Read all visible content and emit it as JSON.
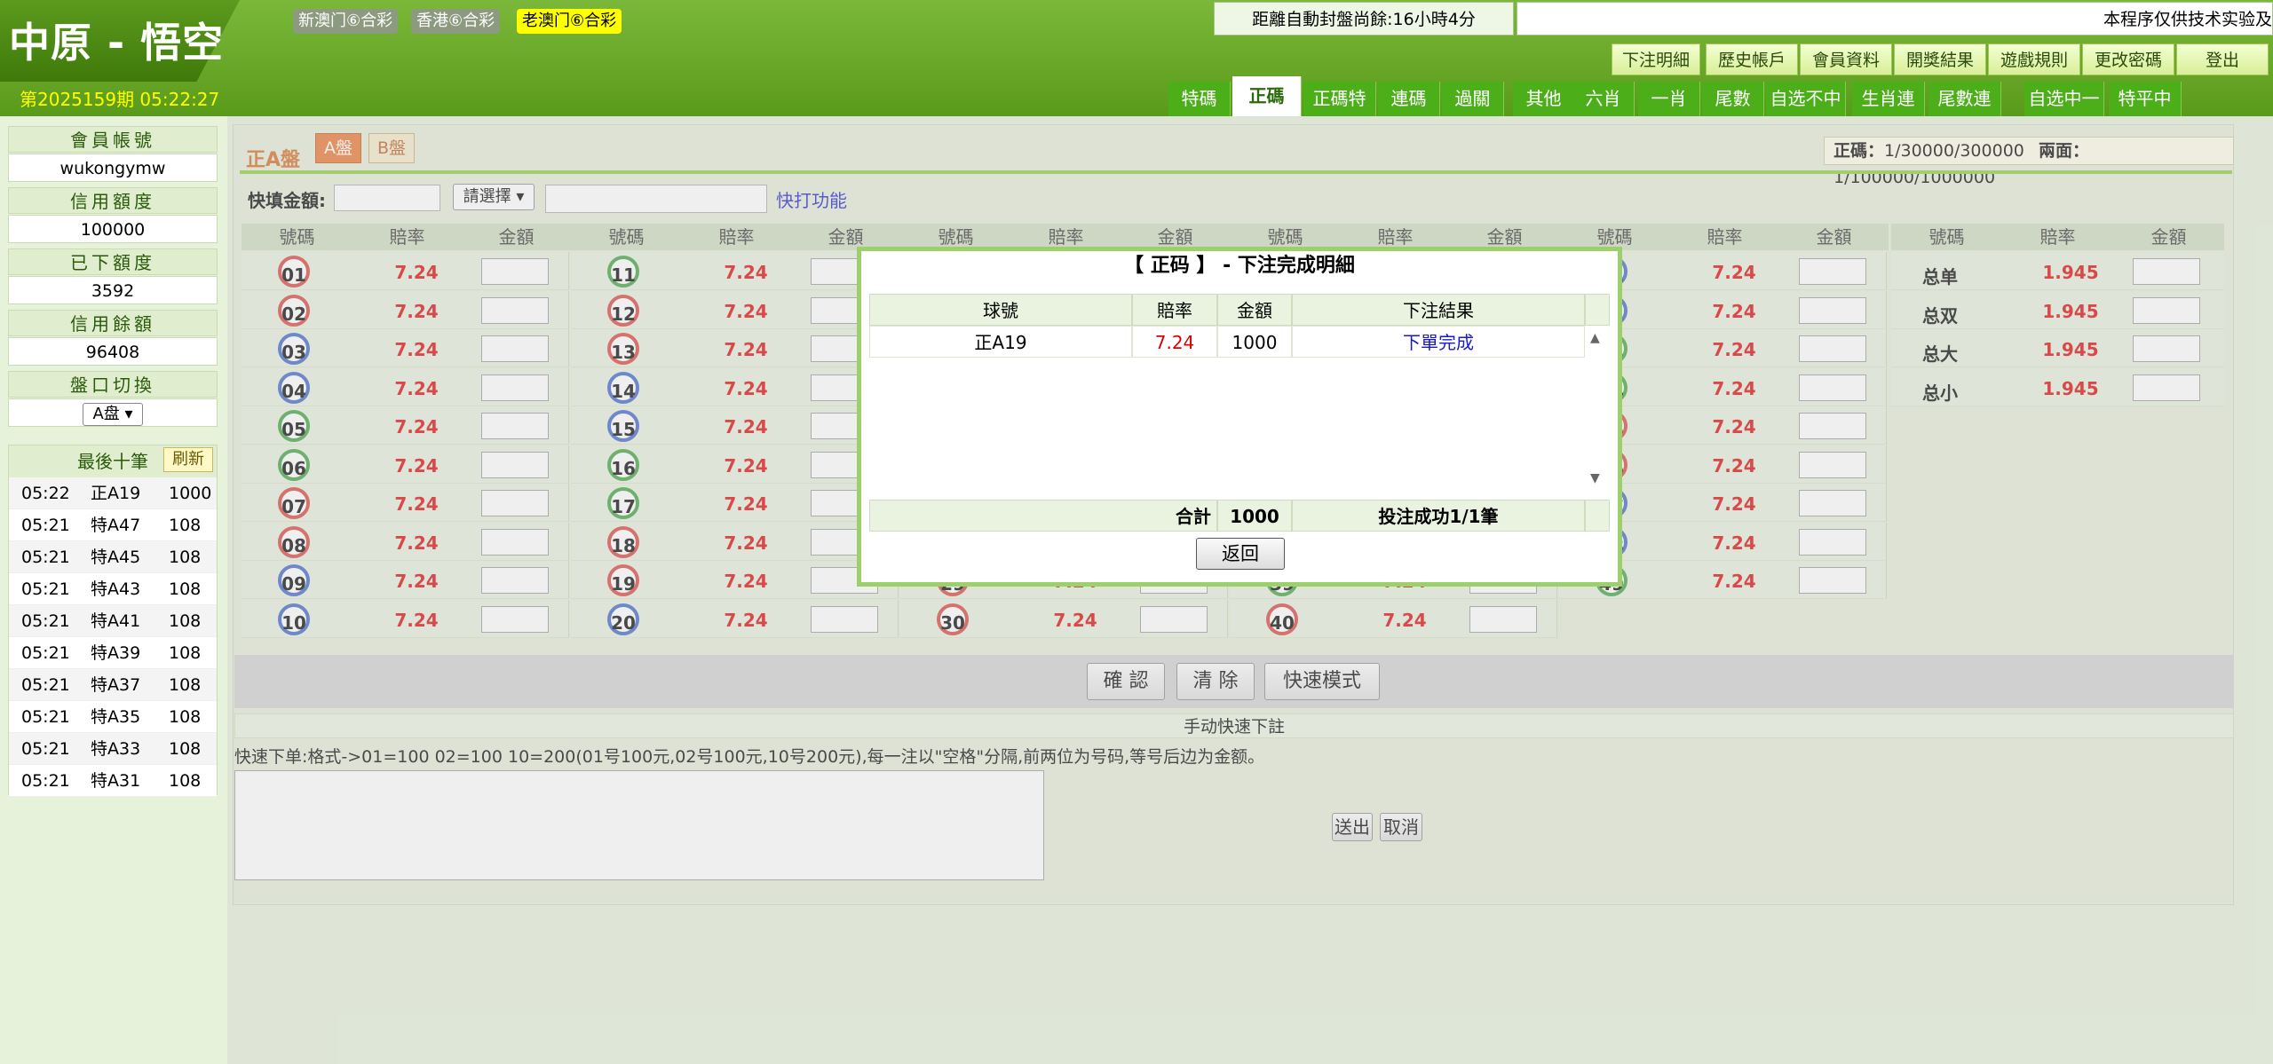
{
  "header": {
    "logo": "中原 - 悟空",
    "period": "第2025159期 05:22:27",
    "lottery_tabs": [
      {
        "label": "新澳门⑥合彩",
        "active": false
      },
      {
        "label": "香港⑥合彩",
        "active": false
      },
      {
        "label": "老澳门⑥合彩",
        "active": true
      }
    ],
    "countdown": "距離自動封盤尚餘:16小時4分",
    "marquee": "本程序仅供技术实验及",
    "top_links": [
      "下注明細",
      "歷史帳戶",
      "會員資料",
      "開獎結果",
      "遊戲規則",
      "更改密碼",
      "登出"
    ],
    "nav_tabs": [
      {
        "label": "特碼",
        "active": false
      },
      {
        "label": "正碼",
        "active": true
      },
      {
        "label": "正碼特",
        "active": false
      },
      {
        "label": "連碼",
        "active": false
      },
      {
        "label": "過關",
        "active": false
      },
      {
        "label": "其他",
        "active": false
      },
      {
        "label": "六肖",
        "active": false
      },
      {
        "label": "一肖",
        "active": false
      },
      {
        "label": "尾數",
        "active": false
      },
      {
        "label": "自选不中",
        "active": false
      },
      {
        "label": "生肖連",
        "active": false
      },
      {
        "label": "尾數連",
        "active": false
      },
      {
        "label": "自选中一",
        "active": false
      },
      {
        "label": "特平中",
        "active": false
      }
    ]
  },
  "sidebar": {
    "account_label": "會員帳號",
    "account": "wukongymw",
    "credit_label": "信用額度",
    "credit": "100000",
    "placed_label": "已下額度",
    "placed": "3592",
    "balance_label": "信用餘額",
    "balance": "96408",
    "switch_label": "盤口切換",
    "switch_value": "A盘",
    "last_ten_label": "最後十筆",
    "refresh_label": "刷新",
    "last_ten": [
      {
        "time": "05:22",
        "item": "正A19",
        "amount": "1000"
      },
      {
        "time": "05:21",
        "item": "特A47",
        "amount": "108"
      },
      {
        "time": "05:21",
        "item": "特A45",
        "amount": "108"
      },
      {
        "time": "05:21",
        "item": "特A43",
        "amount": "108"
      },
      {
        "time": "05:21",
        "item": "特A41",
        "amount": "108"
      },
      {
        "time": "05:21",
        "item": "特A39",
        "amount": "108"
      },
      {
        "time": "05:21",
        "item": "特A37",
        "amount": "108"
      },
      {
        "time": "05:21",
        "item": "特A35",
        "amount": "108"
      },
      {
        "time": "05:21",
        "item": "特A33",
        "amount": "108"
      },
      {
        "time": "05:21",
        "item": "特A31",
        "amount": "108"
      }
    ]
  },
  "main": {
    "panel_title": "正A盤",
    "plate_a": "A盤",
    "plate_b": "B盤",
    "limits_zhengma_label": "正碼：",
    "limits_zhengma": "1/30000/300000",
    "limits_liangmian_label": "兩面：",
    "limits_liangmian": "1/100000/1000000",
    "quick_amount_label": "快填金額:",
    "select_placeholder": "請選擇",
    "quick_func": "快打功能",
    "col_headers": [
      "號碼",
      "賠率",
      "金額"
    ],
    "odds": "7.24",
    "side_bets": [
      {
        "label": "总单",
        "odds": "1.945"
      },
      {
        "label": "总双",
        "odds": "1.945"
      },
      {
        "label": "总大",
        "odds": "1.945"
      },
      {
        "label": "总小",
        "odds": "1.945"
      }
    ],
    "confirm_label": "確 認",
    "clear_label": "清 除",
    "fast_mode_label": "快速模式",
    "manual_quick_label": "手动快速下註",
    "quick_hint": "快速下单:格式->01=100 02=100 10=200(01号100元,02号100元,10号200元),每一注以\"空格\"分隔,前两位为号码,等号后边为金额。",
    "send_label": "送出",
    "cancel_label": "取消"
  },
  "modal": {
    "title": "【 正码 】 - 下注完成明細",
    "headers": [
      "球號",
      "賠率",
      "金額",
      "下注結果"
    ],
    "rows": [
      {
        "item": "正A19",
        "odds": "7.24",
        "amount": "1000",
        "result": "下單完成"
      }
    ],
    "total_label": "合計",
    "total_amount": "1000",
    "success_text": "投注成功1/1筆",
    "back_label": "返回"
  },
  "colors": {
    "header_green": "#5a9a1a",
    "odds_red": "#dd0000",
    "link_blue": "#1a1acc",
    "ball_red": "#d8403a",
    "ball_blue": "#3a62c8",
    "ball_green": "#3aa03a"
  }
}
